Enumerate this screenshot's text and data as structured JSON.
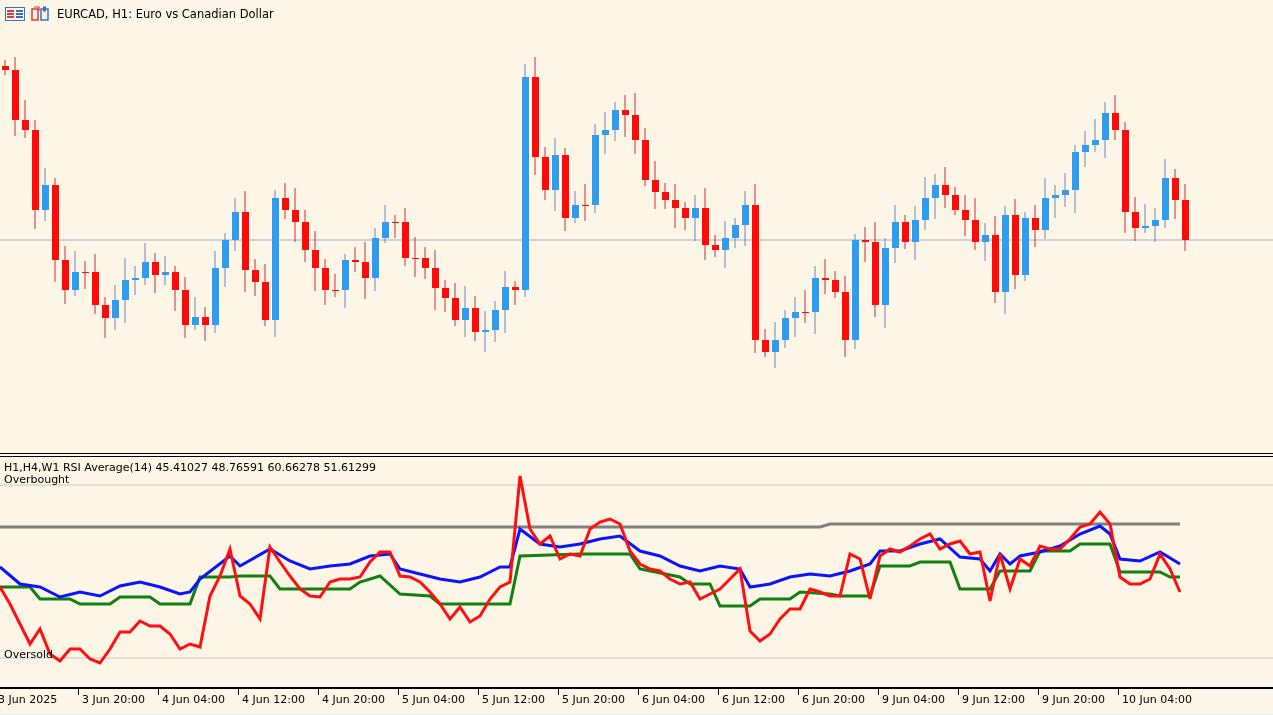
{
  "chart": {
    "title": "EURCAD, H1:  Euro vs Canadian Dollar"
  },
  "indicator": {
    "label": "H1,H4,W1 RSI Average(14) 45.41027 48.76591 60.66278 51.61299",
    "overbought_label": "Overbought",
    "oversold_label": "Oversold"
  },
  "time_axis": [
    "3 Jun 2025",
    "3 Jun 20:00",
    "4 Jun 04:00",
    "4 Jun 12:00",
    "4 Jun 20:00",
    "5 Jun 04:00",
    "5 Jun 12:00",
    "5 Jun 20:00",
    "6 Jun 04:00",
    "6 Jun 12:00",
    "6 Jun 20:00",
    "9 Jun 04:00",
    "9 Jun 12:00",
    "9 Jun 20:00",
    "10 Jun 04:00"
  ]
}
